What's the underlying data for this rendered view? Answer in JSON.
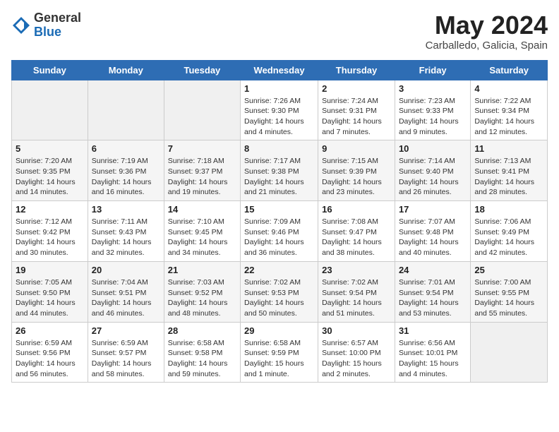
{
  "header": {
    "logo_general": "General",
    "logo_blue": "Blue",
    "month_title": "May 2024",
    "location": "Carballedo, Galicia, Spain"
  },
  "weekdays": [
    "Sunday",
    "Monday",
    "Tuesday",
    "Wednesday",
    "Thursday",
    "Friday",
    "Saturday"
  ],
  "weeks": [
    [
      {
        "day": "",
        "info": ""
      },
      {
        "day": "",
        "info": ""
      },
      {
        "day": "",
        "info": ""
      },
      {
        "day": "1",
        "info": "Sunrise: 7:26 AM\nSunset: 9:30 PM\nDaylight: 14 hours\nand 4 minutes."
      },
      {
        "day": "2",
        "info": "Sunrise: 7:24 AM\nSunset: 9:31 PM\nDaylight: 14 hours\nand 7 minutes."
      },
      {
        "day": "3",
        "info": "Sunrise: 7:23 AM\nSunset: 9:33 PM\nDaylight: 14 hours\nand 9 minutes."
      },
      {
        "day": "4",
        "info": "Sunrise: 7:22 AM\nSunset: 9:34 PM\nDaylight: 14 hours\nand 12 minutes."
      }
    ],
    [
      {
        "day": "5",
        "info": "Sunrise: 7:20 AM\nSunset: 9:35 PM\nDaylight: 14 hours\nand 14 minutes."
      },
      {
        "day": "6",
        "info": "Sunrise: 7:19 AM\nSunset: 9:36 PM\nDaylight: 14 hours\nand 16 minutes."
      },
      {
        "day": "7",
        "info": "Sunrise: 7:18 AM\nSunset: 9:37 PM\nDaylight: 14 hours\nand 19 minutes."
      },
      {
        "day": "8",
        "info": "Sunrise: 7:17 AM\nSunset: 9:38 PM\nDaylight: 14 hours\nand 21 minutes."
      },
      {
        "day": "9",
        "info": "Sunrise: 7:15 AM\nSunset: 9:39 PM\nDaylight: 14 hours\nand 23 minutes."
      },
      {
        "day": "10",
        "info": "Sunrise: 7:14 AM\nSunset: 9:40 PM\nDaylight: 14 hours\nand 26 minutes."
      },
      {
        "day": "11",
        "info": "Sunrise: 7:13 AM\nSunset: 9:41 PM\nDaylight: 14 hours\nand 28 minutes."
      }
    ],
    [
      {
        "day": "12",
        "info": "Sunrise: 7:12 AM\nSunset: 9:42 PM\nDaylight: 14 hours\nand 30 minutes."
      },
      {
        "day": "13",
        "info": "Sunrise: 7:11 AM\nSunset: 9:43 PM\nDaylight: 14 hours\nand 32 minutes."
      },
      {
        "day": "14",
        "info": "Sunrise: 7:10 AM\nSunset: 9:45 PM\nDaylight: 14 hours\nand 34 minutes."
      },
      {
        "day": "15",
        "info": "Sunrise: 7:09 AM\nSunset: 9:46 PM\nDaylight: 14 hours\nand 36 minutes."
      },
      {
        "day": "16",
        "info": "Sunrise: 7:08 AM\nSunset: 9:47 PM\nDaylight: 14 hours\nand 38 minutes."
      },
      {
        "day": "17",
        "info": "Sunrise: 7:07 AM\nSunset: 9:48 PM\nDaylight: 14 hours\nand 40 minutes."
      },
      {
        "day": "18",
        "info": "Sunrise: 7:06 AM\nSunset: 9:49 PM\nDaylight: 14 hours\nand 42 minutes."
      }
    ],
    [
      {
        "day": "19",
        "info": "Sunrise: 7:05 AM\nSunset: 9:50 PM\nDaylight: 14 hours\nand 44 minutes."
      },
      {
        "day": "20",
        "info": "Sunrise: 7:04 AM\nSunset: 9:51 PM\nDaylight: 14 hours\nand 46 minutes."
      },
      {
        "day": "21",
        "info": "Sunrise: 7:03 AM\nSunset: 9:52 PM\nDaylight: 14 hours\nand 48 minutes."
      },
      {
        "day": "22",
        "info": "Sunrise: 7:02 AM\nSunset: 9:53 PM\nDaylight: 14 hours\nand 50 minutes."
      },
      {
        "day": "23",
        "info": "Sunrise: 7:02 AM\nSunset: 9:54 PM\nDaylight: 14 hours\nand 51 minutes."
      },
      {
        "day": "24",
        "info": "Sunrise: 7:01 AM\nSunset: 9:54 PM\nDaylight: 14 hours\nand 53 minutes."
      },
      {
        "day": "25",
        "info": "Sunrise: 7:00 AM\nSunset: 9:55 PM\nDaylight: 14 hours\nand 55 minutes."
      }
    ],
    [
      {
        "day": "26",
        "info": "Sunrise: 6:59 AM\nSunset: 9:56 PM\nDaylight: 14 hours\nand 56 minutes."
      },
      {
        "day": "27",
        "info": "Sunrise: 6:59 AM\nSunset: 9:57 PM\nDaylight: 14 hours\nand 58 minutes."
      },
      {
        "day": "28",
        "info": "Sunrise: 6:58 AM\nSunset: 9:58 PM\nDaylight: 14 hours\nand 59 minutes."
      },
      {
        "day": "29",
        "info": "Sunrise: 6:58 AM\nSunset: 9:59 PM\nDaylight: 15 hours\nand 1 minute."
      },
      {
        "day": "30",
        "info": "Sunrise: 6:57 AM\nSunset: 10:00 PM\nDaylight: 15 hours\nand 2 minutes."
      },
      {
        "day": "31",
        "info": "Sunrise: 6:56 AM\nSunset: 10:01 PM\nDaylight: 15 hours\nand 4 minutes."
      },
      {
        "day": "",
        "info": ""
      }
    ]
  ]
}
